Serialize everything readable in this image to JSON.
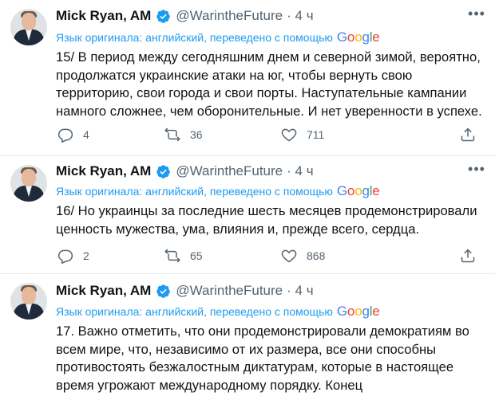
{
  "tweets": [
    {
      "author": "Mick Ryan, AM",
      "handle": "@WarintheFuture",
      "time": "· 4 ч",
      "translation_note": "Язык оригинала: английский, переведено с помощью",
      "google": "Google",
      "text": "15/ В период между сегодняшним днем и северной зимой, вероятно,\nпродолжатся украинские атаки на юг, чтобы вернуть свою\nтерриторию, свои города и свои порты. Наступательные кампании\nнамного сложнее, чем оборонительные. И нет уверенности в успехе.",
      "replies": "4",
      "retweets": "36",
      "likes": "711"
    },
    {
      "author": "Mick Ryan, AM",
      "handle": "@WarintheFuture",
      "time": "· 4 ч",
      "translation_note": "Язык оригинала: английский, переведено с помощью",
      "google": "Google",
      "text": "16/ Но украинцы за последние шесть месяцев продемонстрировали\nценность мужества, ума, влияния и, прежде всего, сердца.",
      "replies": "2",
      "retweets": "65",
      "likes": "868"
    },
    {
      "author": "Mick Ryan, AM",
      "handle": "@WarintheFuture",
      "time": "· 4 ч",
      "translation_note": "Язык оригинала: английский, переведено с помощью",
      "google": "Google",
      "text": "17. Важно отметить, что они продемонстрировали демократиям во\nвсем мире, что, независимо от их размера, все они способны\nпротивостоять безжалостным диктатурам, которые в настоящее\nвремя угрожают международному порядку. Конец"
    }
  ],
  "colors": {
    "accent": "#1d9bf0",
    "secondary_text": "#536471",
    "divider": "#e7eaed"
  },
  "icons": [
    "verified-badge-icon",
    "more-options-icon",
    "reply-icon",
    "retweet-icon",
    "like-icon",
    "share-icon"
  ]
}
